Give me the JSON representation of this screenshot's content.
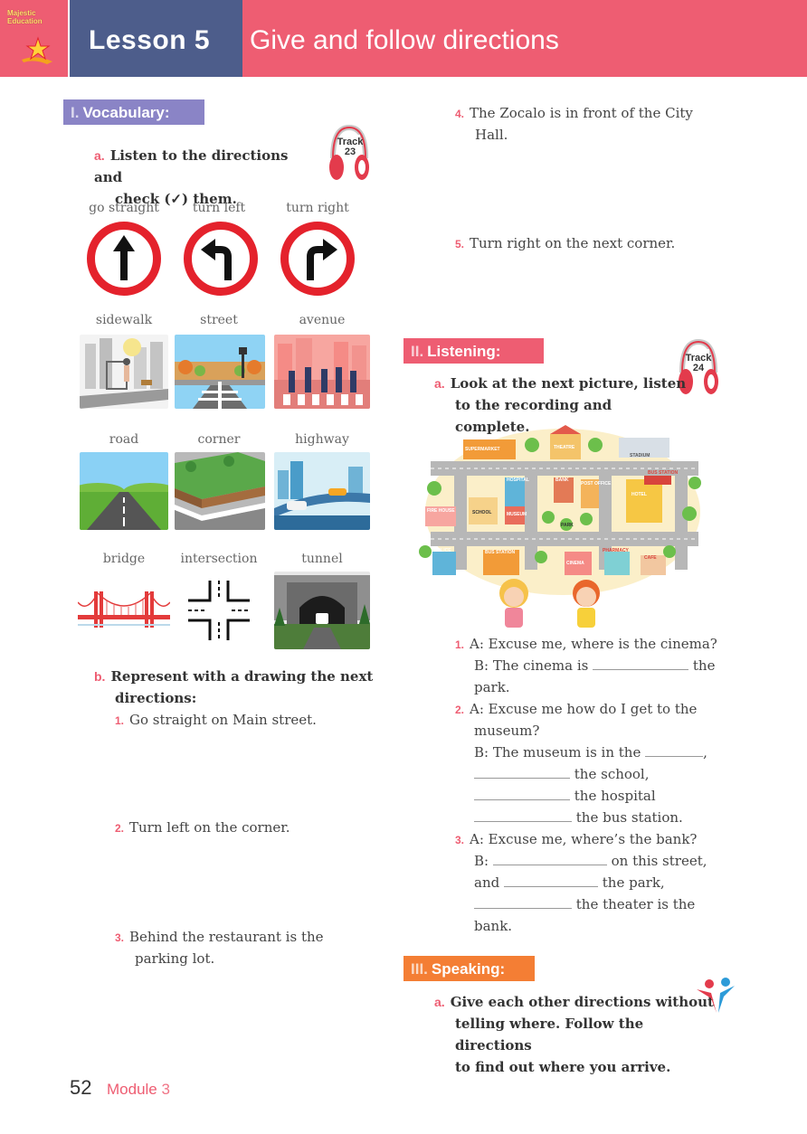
{
  "header": {
    "logo_text_1": "Majestic",
    "logo_text_2": "Education",
    "lesson_label": "Lesson 5",
    "lesson_title": "Give and follow directions"
  },
  "vocabulary": {
    "num": "I.",
    "title": "Vocabulary:",
    "a_label": "a.",
    "a_text_1": "Listen to the directions and",
    "a_text_2": "check (✓) them.",
    "track_label": "Track",
    "track_num": "23",
    "words": [
      "go straight",
      "turn left",
      "turn right",
      "sidewalk",
      "street",
      "avenue",
      "road",
      "corner",
      "highway",
      "bridge",
      "intersection",
      "tunnel"
    ],
    "b_label": "b.",
    "b_text_1": "Represent with a drawing the next",
    "b_text_2": "directions:",
    "b_items": [
      {
        "num": "1.",
        "text_1": "Go straight on Main street.",
        "text_2": ""
      },
      {
        "num": "2.",
        "text_1": "Turn left on the corner.",
        "text_2": ""
      },
      {
        "num": "3.",
        "text_1": "Behind the restaurant is the",
        "text_2": "parking lot."
      }
    ],
    "right_items": [
      {
        "num": "4.",
        "text_1": "The Zocalo is in front of the City",
        "text_2": "Hall."
      },
      {
        "num": "5.",
        "text_1": "Turn right on the next corner.",
        "text_2": ""
      }
    ]
  },
  "listening": {
    "num": "II.",
    "title": "Listening:",
    "a_label": "a.",
    "a_text_1": "Look at the next picture, listen",
    "a_text_2": "to the recording and complete.",
    "track_label": "Track",
    "track_num": "24",
    "map_labels": {
      "supermarket": "SUPERMARKET",
      "theatre": "THEATRE",
      "stadium": "STADIUM",
      "hospital": "HOSPITAL",
      "bank": "BANK",
      "post_office": "POST OFFICE",
      "bus_station_top": "BUS STATION",
      "hotel": "HOTEL",
      "fire_house": "FIRE HOUSE",
      "school": "SCHOOL",
      "museum": "MUSEUM",
      "park": "PARK",
      "police": "POLICE",
      "bus_station": "BUS STATION",
      "cinema": "CINEMA",
      "pharmacy": "PHARMACY",
      "cafe": "CAFE"
    },
    "q1_num": "1.",
    "q1_a": "A: Excuse me, where is the cinema?",
    "q1_b1": "B: The cinema is",
    "q1_b2": "the",
    "q1_b3": "park.",
    "q2_num": "2.",
    "q2_a1": "A: Excuse me how do I get to the",
    "q2_a2": "museum?",
    "q2_b1": "B: The museum is in the",
    "q2_b2": ",",
    "q2_b3": "the school,",
    "q2_b4": "the hospital",
    "q2_b5": "the bus station.",
    "q3_num": "3.",
    "q3_a": "A: Excuse me, where’s the bank?",
    "q3_b1": "B:",
    "q3_b2": "on this street,",
    "q3_b3": "and",
    "q3_b4": "the park,",
    "q3_b5": "the theater is the",
    "q3_b6": "bank."
  },
  "speaking": {
    "num": "III.",
    "title": "Speaking:",
    "a_label": "a.",
    "a_text_1": "Give each other directions without",
    "a_text_2": "telling where. Follow the directions",
    "a_text_3": "to find out where you arrive."
  },
  "footer": {
    "page_number": "52",
    "module_label": "Module",
    "module_number": "3"
  },
  "colors": {
    "header_pink": "#ee5d72",
    "lesson_navy": "#4d5d8b",
    "vocab_purple": "#8a84c6",
    "speaking_orange": "#f47e34",
    "sign_red": "#e4222c"
  }
}
